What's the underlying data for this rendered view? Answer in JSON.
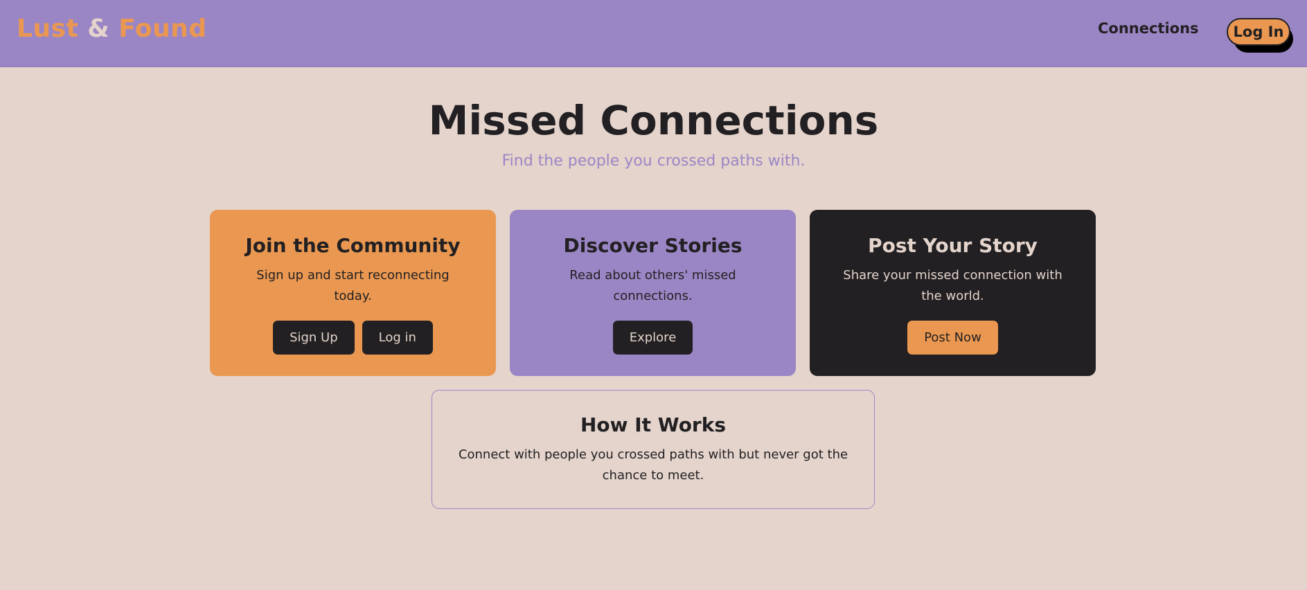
{
  "header": {
    "brand_part1": "Lust",
    "brand_amp": "&",
    "brand_part2": "Found",
    "nav_connections": "Connections",
    "login_label": "Log In"
  },
  "hero": {
    "title": "Missed Connections",
    "subtitle": "Find the people you crossed paths with."
  },
  "cards": {
    "join": {
      "title": "Join the Community",
      "text": "Sign up and start reconnecting today.",
      "signup_label": "Sign Up",
      "login_label": "Log in"
    },
    "discover": {
      "title": "Discover Stories",
      "text": "Read about others' missed connections.",
      "explore_label": "Explore"
    },
    "post": {
      "title": "Post Your Story",
      "text": "Share your missed connection with the world.",
      "post_label": "Post Now"
    }
  },
  "how": {
    "title": "How It Works",
    "text": "Connect with people you crossed paths with but never got the chance to meet."
  },
  "colors": {
    "background": "#e4d4cc",
    "purple": "#9b86c5",
    "orange": "#ea9851",
    "dark": "#222022"
  }
}
